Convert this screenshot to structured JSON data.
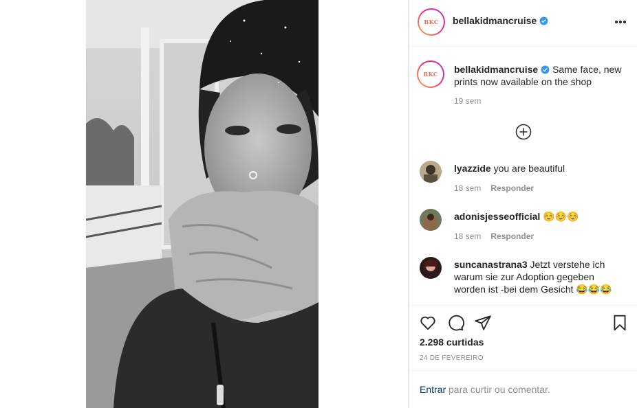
{
  "post": {
    "author": "bellakidmancruise",
    "avatar_logo": "BKC",
    "verified": true,
    "more_icon": "more-horizontal-icon"
  },
  "caption": {
    "author": "bellakidmancruise",
    "text": "Same face, new prints now available on the shop",
    "age": "19 sem"
  },
  "load_more_icon": "plus-circle-icon",
  "comments": [
    {
      "user": "lyazzide",
      "text": "you are beautiful",
      "age": "18 sem",
      "reply_label": "Responder"
    },
    {
      "user": "adonisjesseofficial",
      "text": "☺️☺️☺️",
      "age": "18 sem",
      "reply_label": "Responder"
    },
    {
      "user": "suncanastrana3",
      "text": "Jetzt verstehe ich warum sie zur Adoption gegeben worden ist -bei dem Gesicht 😂😂😂",
      "age": "",
      "reply_label": ""
    }
  ],
  "actions": {
    "like_icon": "heart-icon",
    "comment_icon": "comment-icon",
    "share_icon": "paper-plane-icon",
    "save_icon": "bookmark-icon"
  },
  "likes": "2.298 curtidas",
  "date": "24 DE FEVEREIRO",
  "login": {
    "link": "Entrar",
    "rest": " para curtir ou comentar."
  },
  "colors": {
    "text": "#262626",
    "muted": "#8e8e8e",
    "verified": "#3897f0",
    "link": "#00376b",
    "border": "#dbdbdb"
  }
}
